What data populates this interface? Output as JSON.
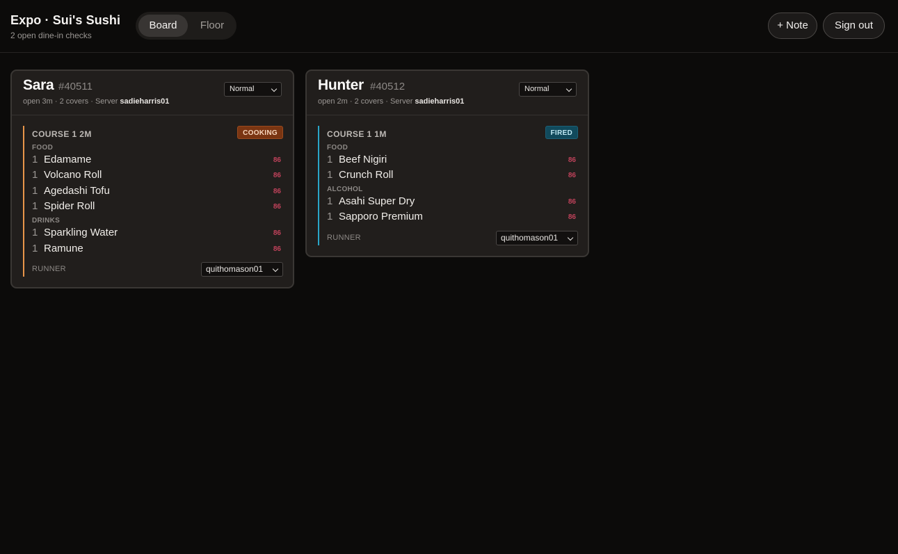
{
  "header": {
    "title": "Expo · Sui's Sushi",
    "subtitle": "2 open dine-in checks",
    "tabs": [
      {
        "label": "Board",
        "active": true
      },
      {
        "label": "Floor",
        "active": false
      }
    ],
    "note_button": "+ Note",
    "signout_button": "Sign out"
  },
  "checks": [
    {
      "guest": "Sara",
      "number": "#40511",
      "open_time": "open 3m",
      "covers": "· 2 covers",
      "server_label": "· Server",
      "server": "sadieharris01",
      "priority": "Normal",
      "course": {
        "title": "COURSE 1  2M",
        "status": "COOKING",
        "status_color": "#7a3512",
        "accent_color": "#e8954a",
        "sections": [
          {
            "label": "FOOD",
            "items": [
              {
                "qty": "1",
                "name": "Edamame",
                "action": "86"
              },
              {
                "qty": "1",
                "name": "Volcano Roll",
                "action": "86"
              },
              {
                "qty": "1",
                "name": "Agedashi Tofu",
                "action": "86"
              },
              {
                "qty": "1",
                "name": "Spider Roll",
                "action": "86"
              }
            ]
          },
          {
            "label": "DRINKS",
            "items": [
              {
                "qty": "1",
                "name": "Sparkling Water",
                "action": "86"
              },
              {
                "qty": "1",
                "name": "Ramune",
                "action": "86"
              }
            ]
          }
        ],
        "runner_label": "RUNNER",
        "runner": "quithomason01"
      }
    },
    {
      "guest": "Hunter",
      "number": "#40512",
      "open_time": "open 2m",
      "covers": "· 2 covers",
      "server_label": "· Server",
      "server": "sadieharris01",
      "priority": "Normal",
      "course": {
        "title": "COURSE 1  1M",
        "status": "FIRED",
        "status_color": "#114a5c",
        "accent_color": "#2aa6c8",
        "sections": [
          {
            "label": "FOOD",
            "items": [
              {
                "qty": "1",
                "name": "Beef Nigiri",
                "action": "86"
              },
              {
                "qty": "1",
                "name": "Crunch Roll",
                "action": "86"
              }
            ]
          },
          {
            "label": "ALCOHOL",
            "items": [
              {
                "qty": "1",
                "name": "Asahi Super Dry",
                "action": "86"
              },
              {
                "qty": "1",
                "name": "Sapporo Premium",
                "action": "86"
              }
            ]
          }
        ],
        "runner_label": "RUNNER",
        "runner": "quithomason01"
      }
    }
  ]
}
